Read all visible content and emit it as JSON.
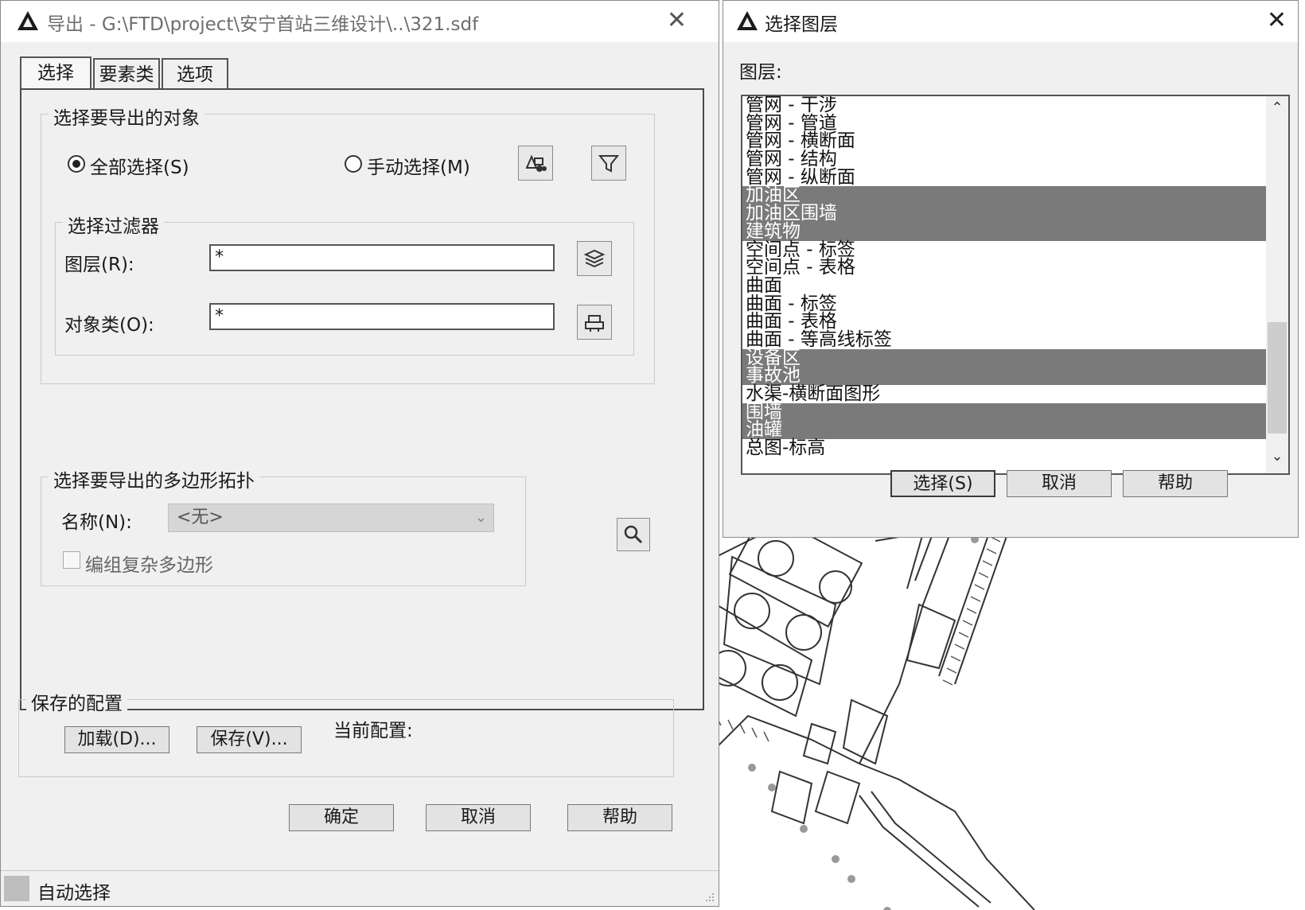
{
  "export_dialog": {
    "title": "导出 - G:\\FTD\\project\\安宁首站三维设计\\..\\321.sdf",
    "tabs": [
      {
        "label": "选择",
        "active": true
      },
      {
        "label": "要素类",
        "active": false
      },
      {
        "label": "选项",
        "active": false
      }
    ],
    "select_group": {
      "title": "选择要导出的对象",
      "radio_all": "全部选择(S)",
      "radio_manual": "手动选择(M)",
      "selected": "all"
    },
    "filter_group": {
      "title": "选择过滤器",
      "layer_label": "图层(R):",
      "layer_value": "*",
      "class_label": "对象类(O):",
      "class_value": "*"
    },
    "polygon_group": {
      "title": "选择要导出的多边形拓扑",
      "name_label": "名称(N):",
      "name_value": "<无>",
      "checkbox_label": "编组复杂多边形"
    },
    "saved_config": {
      "title": "保存的配置",
      "load_label": "加载(D)...",
      "save_label": "保存(V)...",
      "current_label": "当前配置:"
    },
    "buttons": {
      "ok": "确定",
      "cancel": "取消",
      "help": "帮助"
    },
    "status": "自动选择"
  },
  "layer_dialog": {
    "title": "选择图层",
    "list_label": "图层:",
    "layers": [
      {
        "name": "管网 - 干涉",
        "selected": false
      },
      {
        "name": "管网 - 管道",
        "selected": false
      },
      {
        "name": "管网 - 横断面",
        "selected": false
      },
      {
        "name": "管网 - 结构",
        "selected": false
      },
      {
        "name": "管网 - 纵断面",
        "selected": false
      },
      {
        "name": "加油区",
        "selected": true
      },
      {
        "name": "加油区围墙",
        "selected": true
      },
      {
        "name": "建筑物",
        "selected": true
      },
      {
        "name": "空间点 - 标签",
        "selected": false
      },
      {
        "name": "空间点 - 表格",
        "selected": false
      },
      {
        "name": "曲面",
        "selected": false
      },
      {
        "name": "曲面 - 标签",
        "selected": false
      },
      {
        "name": "曲面 - 表格",
        "selected": false
      },
      {
        "name": "曲面 - 等高线标签",
        "selected": false
      },
      {
        "name": "设备区",
        "selected": true
      },
      {
        "name": "事故池",
        "selected": true
      },
      {
        "name": "水渠-横断面图形",
        "selected": false
      },
      {
        "name": "围墙",
        "selected": true
      },
      {
        "name": "油罐",
        "selected": true
      },
      {
        "name": "总图-标高",
        "selected": false
      }
    ],
    "buttons": {
      "select": "选择(S)",
      "cancel": "取消",
      "help": "帮助"
    }
  }
}
